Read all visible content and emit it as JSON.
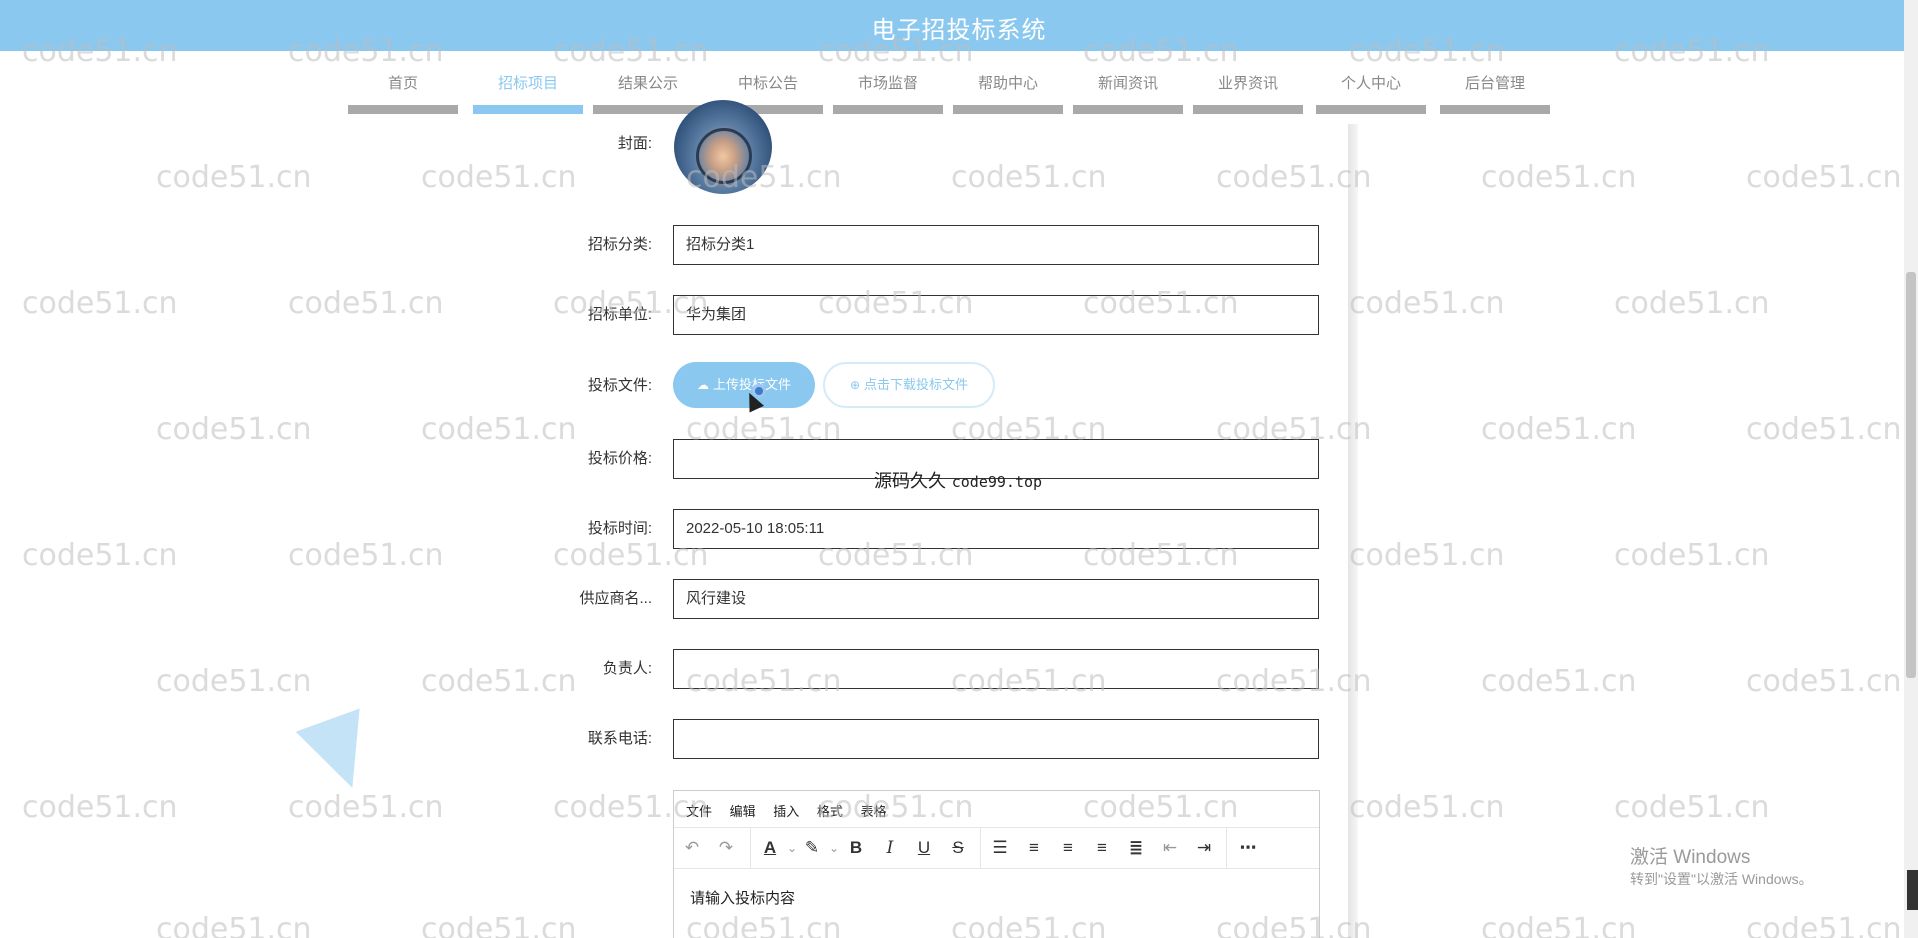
{
  "app": {
    "title": "电子招投标系统"
  },
  "nav": {
    "items": [
      {
        "label": "首页",
        "active": false
      },
      {
        "label": "招标项目",
        "active": true
      },
      {
        "label": "结果公示",
        "active": false
      },
      {
        "label": "中标公告",
        "active": false
      },
      {
        "label": "市场监督",
        "active": false
      },
      {
        "label": "帮助中心",
        "active": false
      },
      {
        "label": "新闻资讯",
        "active": false
      },
      {
        "label": "业界资讯",
        "active": false
      },
      {
        "label": "个人中心",
        "active": false
      },
      {
        "label": "后台管理",
        "active": false
      }
    ]
  },
  "form": {
    "cover_label": "封面:",
    "category": {
      "label": "招标分类:",
      "value": "招标分类1"
    },
    "unit": {
      "label": "招标单位:",
      "value": "华为集团"
    },
    "bid_file": {
      "label": "投标文件:",
      "upload_label": "上传投标文件",
      "download_label": "点击下载投标文件"
    },
    "price": {
      "label": "投标价格:",
      "value": ""
    },
    "time": {
      "label": "投标时间:",
      "value": "2022-05-10 18:05:11"
    },
    "supplier": {
      "label": "供应商名...",
      "value": "风行建设"
    },
    "owner": {
      "label": "负责人:",
      "value": ""
    },
    "phone": {
      "label": "联系电话:",
      "value": ""
    }
  },
  "editor": {
    "menu": [
      "文件",
      "编辑",
      "插入",
      "格式",
      "表格"
    ],
    "placeholder": "请输入投标内容",
    "toolbar_icons": [
      "undo-icon",
      "redo-icon",
      "text-color-icon",
      "highlight-icon",
      "bold-icon",
      "italic-icon",
      "underline-icon",
      "strikethrough-icon",
      "list-icon",
      "align-left-icon",
      "align-center-icon",
      "align-right-icon",
      "justify-icon",
      "outdent-icon",
      "indent-icon",
      "more-icon"
    ]
  },
  "overlay": {
    "cn": "源码久久",
    "en": "code99.top"
  },
  "watermark": "code51.cn",
  "windows": {
    "title": "激活 Windows",
    "sub": "转到\"设置\"以激活 Windows。"
  },
  "colors": {
    "accent": "#8ac8ef",
    "nav_bar": "#a9a9a9"
  }
}
